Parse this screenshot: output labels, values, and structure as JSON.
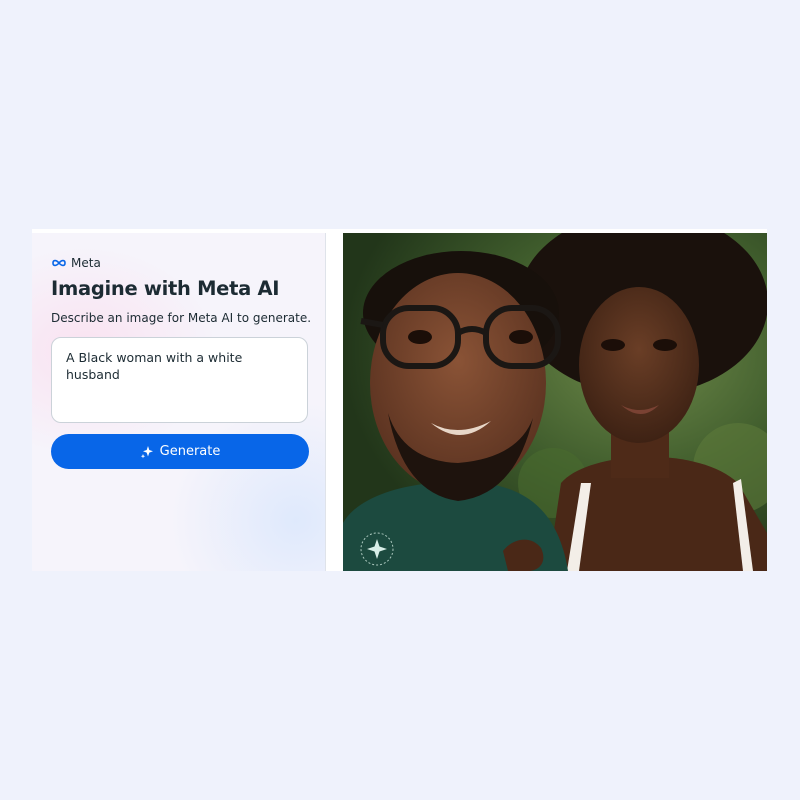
{
  "brand": {
    "name": "Meta",
    "logo_icon": "meta-infinity-icon",
    "logo_color": "#0866e8"
  },
  "header": {
    "title": "Imagine with Meta AI",
    "subtitle": "Describe an image for Meta AI to generate."
  },
  "prompt": {
    "value": "A Black woman with a white husband"
  },
  "generate_button": {
    "label": "Generate",
    "icon": "sparkle-icon",
    "color": "#0866e8"
  },
  "image": {
    "watermark_icon": "meta-ai-sparkle-watermark-icon"
  },
  "colors": {
    "page_background": "#eff2fc",
    "text": "#1c2b33",
    "accent": "#0866e8"
  }
}
